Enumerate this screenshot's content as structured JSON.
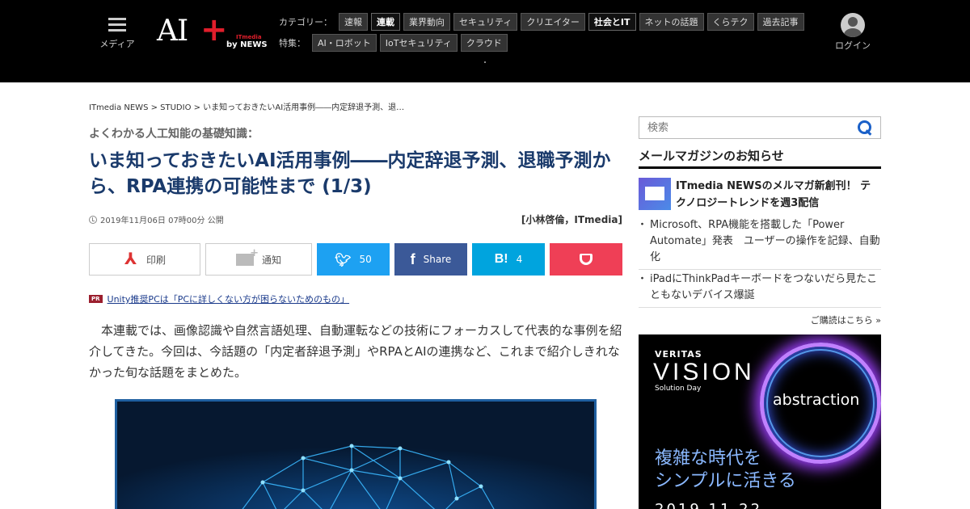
{
  "header": {
    "menu_label": "メディア",
    "logo_ai": "AI",
    "logo_plus": "+",
    "logo_itmedia": "ITmedia",
    "logo_news": "by NEWS",
    "category_label": "カテゴリー：",
    "categories": [
      {
        "label": "速報",
        "active": false
      },
      {
        "label": "連載",
        "active": true
      },
      {
        "label": "業界動向",
        "active": false
      },
      {
        "label": "セキュリティ",
        "active": false
      },
      {
        "label": "クリエイター",
        "active": false
      },
      {
        "label": "社会とIT",
        "active": true
      },
      {
        "label": "ネットの話題",
        "active": false
      },
      {
        "label": "くらテク",
        "active": false
      },
      {
        "label": "過去記事",
        "active": false
      }
    ],
    "feature_label": "特集：",
    "features": [
      "AI・ロボット",
      "IoTセキュリティ",
      "クラウド"
    ],
    "login_label": "ログイン"
  },
  "article": {
    "breadcrumb": "ITmedia NEWS > STUDIO > いま知っておきたいAI活用事例――内定辞退予測、退…",
    "series": "よくわかる人工知能の基礎知識：",
    "title": "いま知っておきたいAI活用事例――内定辞退予測、退職予測から、RPA連携の可能性まで (1/3)",
    "date": "2019年11月06日 07時00分 公開",
    "author": "[小林啓倫，ITmedia]",
    "share": {
      "print": "印刷",
      "notify": "通知",
      "twitter_count": "50",
      "facebook": "Share",
      "hatena_count": "4"
    },
    "pr_badge": "PR",
    "pr_link": "Unity推奨PCは「PCに詳しくない方が困らないためのもの」",
    "body": "本連載では、画像認識や自然言語処理、自動運転などの技術にフォーカスして代表的な事例を紹介してきた。今回は、今話題の「内定者辞退予測」やRPAとAIの連携など、これまで紹介しきれなかった旬な話題をまとめた。"
  },
  "sidebar": {
    "search_placeholder": "検索",
    "mm_title": "メールマガジンのお知らせ",
    "mm_feature": "ITmedia NEWSのメルマガ新創刊！ テクノロジートレンドを週3配信",
    "mm_items": [
      "Microsoft、RPA機能を搭載した「Power Automate」発表　ユーザーの操作を記録、自動化",
      "iPadにThinkPadキーボードをつないだら見たこともないデバイス爆誕"
    ],
    "subscribe": "ご購読はこちら »",
    "ad": {
      "brand": "VERITAS",
      "title": "VISION",
      "subtitle": "Solution Day",
      "ring_text": "abstraction",
      "tagline1": "複雑な時代を",
      "tagline2": "シンプルに活きる",
      "date": "2019.11.22"
    }
  },
  "colors": {
    "title": "#1a3a6b",
    "twitter": "#1da1f2",
    "facebook": "#3b5998",
    "hatena": "#00a4de",
    "pocket": "#ef3f56",
    "logo_red": "#e01e2b"
  }
}
